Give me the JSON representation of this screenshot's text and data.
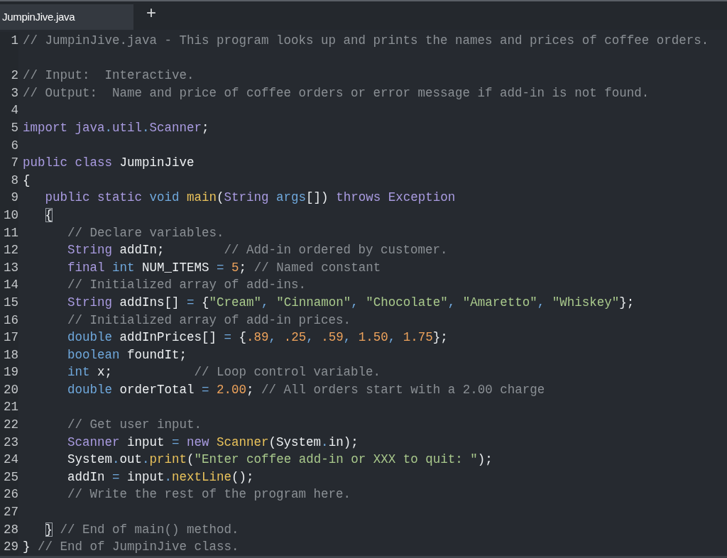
{
  "tabs": [
    {
      "label": "JumpinJive.java",
      "selected": true
    }
  ],
  "new_tab": {
    "label": "+"
  },
  "lines": [
    {
      "number": "1",
      "tokens": [
        {
          "kind": "comment",
          "text": "// JumpinJive.java - This program looks up and prints the names and prices of coffee orders."
        }
      ]
    },
    {
      "number": "2",
      "tokens": [
        {
          "kind": "comment",
          "text": "// Input:  Interactive."
        }
      ]
    },
    {
      "number": "3",
      "tokens": [
        {
          "kind": "comment",
          "text": "// Output:  Name and price of coffee orders or error message if add-in is not found."
        }
      ]
    },
    {
      "number": "4"
    },
    {
      "number": "5",
      "tokens": [
        {
          "kind": "keyword",
          "text": "import java"
        },
        {
          "kind": "operator",
          "text": "."
        },
        {
          "kind": "keyword",
          "text": "util"
        },
        {
          "kind": "operator",
          "text": "."
        },
        {
          "kind": "keyword",
          "text": "Scanner"
        },
        {
          "kind": "plain",
          "text": ";"
        }
      ]
    },
    {
      "number": "6"
    },
    {
      "number": "7",
      "tokens": [
        {
          "kind": "keyword",
          "text": "public class "
        },
        {
          "kind": "plain",
          "text": "JumpinJive"
        }
      ]
    },
    {
      "number": "8",
      "tokens": [
        {
          "kind": "plain",
          "text": "{"
        }
      ]
    },
    {
      "number": "9",
      "tokens": [
        {
          "kind": "keyword",
          "text": "   public static "
        },
        {
          "kind": "type",
          "text": "void "
        },
        {
          "kind": "function",
          "text": "main"
        },
        {
          "kind": "plain",
          "text": "("
        },
        {
          "kind": "keyword",
          "text": "String "
        },
        {
          "kind": "type",
          "text": "args"
        },
        {
          "kind": "plain",
          "text": "[]) "
        },
        {
          "kind": "keyword",
          "text": "throws Exception"
        }
      ]
    },
    {
      "number": "10",
      "tokens": [
        {
          "kind": "plain",
          "text": "   {",
          "matched": true
        }
      ]
    },
    {
      "number": "11",
      "tokens": [
        {
          "kind": "comment",
          "text": "      // Declare variables."
        }
      ]
    },
    {
      "number": "12",
      "tokens": [
        {
          "kind": "keyword",
          "text": "      String"
        },
        {
          "kind": "plain",
          "text": " addIn;        "
        },
        {
          "kind": "comment",
          "text": "// Add-in ordered by customer."
        }
      ]
    },
    {
      "number": "13",
      "tokens": [
        {
          "kind": "keyword",
          "text": "      final "
        },
        {
          "kind": "type",
          "text": "int"
        },
        {
          "kind": "plain",
          "text": " NUM_ITEMS "
        },
        {
          "kind": "operator",
          "text": "= "
        },
        {
          "kind": "number",
          "text": "5"
        },
        {
          "kind": "plain",
          "text": "; "
        },
        {
          "kind": "comment",
          "text": "// Named constant"
        }
      ]
    },
    {
      "number": "14",
      "tokens": [
        {
          "kind": "comment",
          "text": "      // Initialized array of add-ins."
        }
      ]
    },
    {
      "number": "15",
      "tokens": [
        {
          "kind": "keyword",
          "text": "      String"
        },
        {
          "kind": "plain",
          "text": " addIns[] "
        },
        {
          "kind": "operator",
          "text": "="
        },
        {
          "kind": "plain",
          "text": " {"
        },
        {
          "kind": "string",
          "text": "\"Cream\""
        },
        {
          "kind": "operator",
          "text": ", "
        },
        {
          "kind": "string",
          "text": "\"Cinnamon\""
        },
        {
          "kind": "operator",
          "text": ", "
        },
        {
          "kind": "string",
          "text": "\"Chocolate\""
        },
        {
          "kind": "operator",
          "text": ", "
        },
        {
          "kind": "string",
          "text": "\"Amaretto\""
        },
        {
          "kind": "operator",
          "text": ", "
        },
        {
          "kind": "string",
          "text": "\"Whiskey\""
        },
        {
          "kind": "plain",
          "text": "};"
        }
      ]
    },
    {
      "number": "16",
      "tokens": [
        {
          "kind": "comment",
          "text": "      // Initialized array of add-in prices."
        }
      ]
    },
    {
      "number": "17",
      "tokens": [
        {
          "kind": "type",
          "text": "      double"
        },
        {
          "kind": "plain",
          "text": " addInPrices[] "
        },
        {
          "kind": "operator",
          "text": "="
        },
        {
          "kind": "plain",
          "text": " {"
        },
        {
          "kind": "number",
          "text": ".89"
        },
        {
          "kind": "operator",
          "text": ", "
        },
        {
          "kind": "number",
          "text": ".25"
        },
        {
          "kind": "operator",
          "text": ", "
        },
        {
          "kind": "number",
          "text": ".59"
        },
        {
          "kind": "operator",
          "text": ", "
        },
        {
          "kind": "number",
          "text": "1.50"
        },
        {
          "kind": "operator",
          "text": ", "
        },
        {
          "kind": "number",
          "text": "1.75"
        },
        {
          "kind": "plain",
          "text": "};"
        }
      ]
    },
    {
      "number": "18",
      "tokens": [
        {
          "kind": "type",
          "text": "      boolean"
        },
        {
          "kind": "plain",
          "text": " foundIt;"
        }
      ]
    },
    {
      "number": "19",
      "tokens": [
        {
          "kind": "type",
          "text": "      int"
        },
        {
          "kind": "plain",
          "text": " x;           "
        },
        {
          "kind": "comment",
          "text": "// Loop control variable."
        }
      ]
    },
    {
      "number": "20",
      "tokens": [
        {
          "kind": "type",
          "text": "      double"
        },
        {
          "kind": "plain",
          "text": " orderTotal "
        },
        {
          "kind": "operator",
          "text": "= "
        },
        {
          "kind": "number",
          "text": "2.00"
        },
        {
          "kind": "plain",
          "text": "; "
        },
        {
          "kind": "comment",
          "text": "// All orders start with a 2.00 charge"
        }
      ]
    },
    {
      "number": "21"
    },
    {
      "number": "22",
      "tokens": [
        {
          "kind": "comment",
          "text": "      // Get user input."
        }
      ]
    },
    {
      "number": "23",
      "tokens": [
        {
          "kind": "keyword",
          "text": "      Scanner"
        },
        {
          "kind": "plain",
          "text": " input "
        },
        {
          "kind": "operator",
          "text": "= "
        },
        {
          "kind": "keyword",
          "text": "new "
        },
        {
          "kind": "function",
          "text": "Scanner"
        },
        {
          "kind": "plain",
          "text": "(System"
        },
        {
          "kind": "operator",
          "text": "."
        },
        {
          "kind": "plain",
          "text": "in);"
        }
      ]
    },
    {
      "number": "24",
      "tokens": [
        {
          "kind": "plain",
          "text": "      System"
        },
        {
          "kind": "operator",
          "text": "."
        },
        {
          "kind": "plain",
          "text": "out"
        },
        {
          "kind": "operator",
          "text": "."
        },
        {
          "kind": "function",
          "text": "print"
        },
        {
          "kind": "plain",
          "text": "("
        },
        {
          "kind": "string",
          "text": "\"Enter coffee add-in or XXX to quit: \""
        },
        {
          "kind": "plain",
          "text": ");"
        }
      ]
    },
    {
      "number": "25",
      "tokens": [
        {
          "kind": "plain",
          "text": "      addIn "
        },
        {
          "kind": "operator",
          "text": "="
        },
        {
          "kind": "plain",
          "text": " input"
        },
        {
          "kind": "operator",
          "text": "."
        },
        {
          "kind": "function",
          "text": "nextLine"
        },
        {
          "kind": "plain",
          "text": "();"
        }
      ]
    },
    {
      "number": "26",
      "tokens": [
        {
          "kind": "comment",
          "text": "      // Write the rest of the program here."
        }
      ]
    },
    {
      "number": "27"
    },
    {
      "number": "28",
      "tokens": [
        {
          "kind": "plain",
          "text": "   }",
          "matched": true
        },
        {
          "kind": "comment",
          "text": " // End of main() method."
        }
      ]
    },
    {
      "number": "29",
      "tokens": [
        {
          "kind": "plain",
          "text": "} "
        },
        {
          "kind": "comment",
          "text": "// End of JumpinJive class."
        }
      ]
    }
  ]
}
